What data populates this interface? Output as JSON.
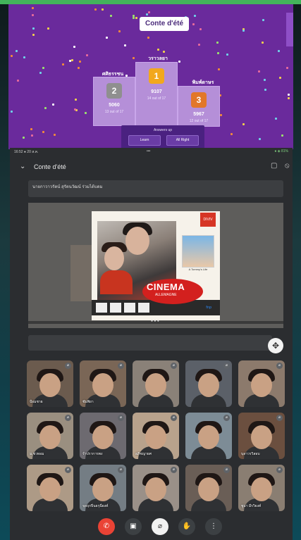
{
  "kahoot": {
    "title": "Conte d'été",
    "podium": [
      {
        "place": "2",
        "name": "ศศิธรรชน",
        "score": "5060",
        "of": "13 out of 17",
        "medal_color": "#8f8f8f"
      },
      {
        "place": "1",
        "name": "วราวลยา",
        "score": "9107",
        "of": "14 out of 17",
        "medal_color": "#f2a81d"
      },
      {
        "place": "3",
        "name": "พิมพ์ดาษร",
        "score": "5967",
        "of": "12 out of 17",
        "medal_color": "#e27729"
      }
    ],
    "answers_label": "Answers up",
    "answer_buttons": [
      "Learn",
      "All Right"
    ],
    "colors": {
      "bg": "#6a2a9c",
      "podium": "#b58fd8"
    }
  },
  "tablet": {
    "status_left": "16:52 ● 20 ส.ค.",
    "status_center": "•••",
    "status_right": "● ◈ 81%",
    "meet_name": "Conte d'été",
    "chat_banner": "นายกาวาวรัตน์ สุรัตนวัฒน์ ร่วมได้บดม",
    "slide": {
      "title": "CINEMA",
      "subtitle": "ALLEMAGNE",
      "badge": "DIVIV",
      "poster_caption": "A Tommy's Life",
      "logo": "fnp"
    },
    "participants": [
      [
        "ป้อมชาย",
        "ชัมพิยา",
        "",
        "",
        ""
      ],
      [
        "ม.ชวทอม",
        "ร่ำปราการพง",
        "อภิชญายศ",
        "",
        "บุลาวรวิสอบ"
      ],
      [
        "",
        "จุลฤกปิ่นธรุนี่ยงค์",
        "",
        "",
        "ชูมา  มีรวิยงค์"
      ]
    ],
    "controls": [
      "end-call",
      "camera",
      "mic-off",
      "raise-hand",
      "more"
    ]
  }
}
